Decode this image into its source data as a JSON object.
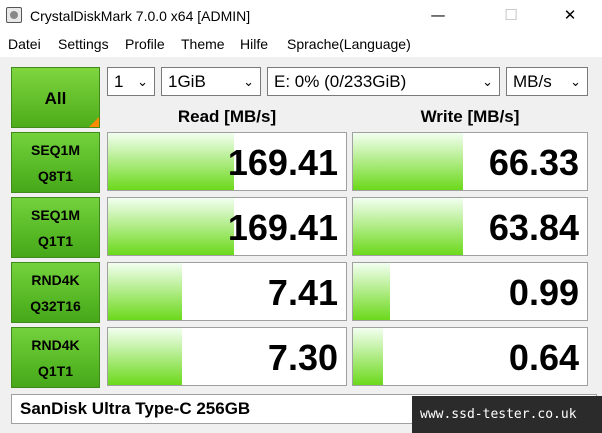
{
  "window": {
    "title": "CrystalDiskMark 7.0.0 x64 [ADMIN]",
    "minimize": "—",
    "maximize": "☐",
    "close": "✕"
  },
  "menu": [
    "Datei",
    "Settings",
    "Profile",
    "Theme",
    "Hilfe",
    "Sprache(Language)"
  ],
  "controls": {
    "all_label": "All",
    "count": "1",
    "size": "1GiB",
    "drive": "E: 0% (0/233GiB)",
    "unit": "MB/s"
  },
  "headers": {
    "read": "Read [MB/s]",
    "write": "Write [MB/s]"
  },
  "tests": [
    {
      "line1": "SEQ1M",
      "line2": "Q8T1",
      "read": "169.41",
      "write": "66.33",
      "read_fill": 0.53,
      "write_fill": 0.47
    },
    {
      "line1": "SEQ1M",
      "line2": "Q1T1",
      "read": "169.41",
      "write": "63.84",
      "read_fill": 0.53,
      "write_fill": 0.47
    },
    {
      "line1": "RND4K",
      "line2": "Q32T16",
      "read": "7.41",
      "write": "0.99",
      "read_fill": 0.31,
      "write_fill": 0.16
    },
    {
      "line1": "RND4K",
      "line2": "Q1T1",
      "read": "7.30",
      "write": "0.64",
      "read_fill": 0.31,
      "write_fill": 0.13
    }
  ],
  "footer": "SanDisk Ultra Type-C 256GB",
  "watermark": "www.ssd-tester.co.uk",
  "colors": {
    "accent_green": "#5cc41f",
    "bar_green": "#6cd91b",
    "corner_orange": "#ff8a00"
  }
}
